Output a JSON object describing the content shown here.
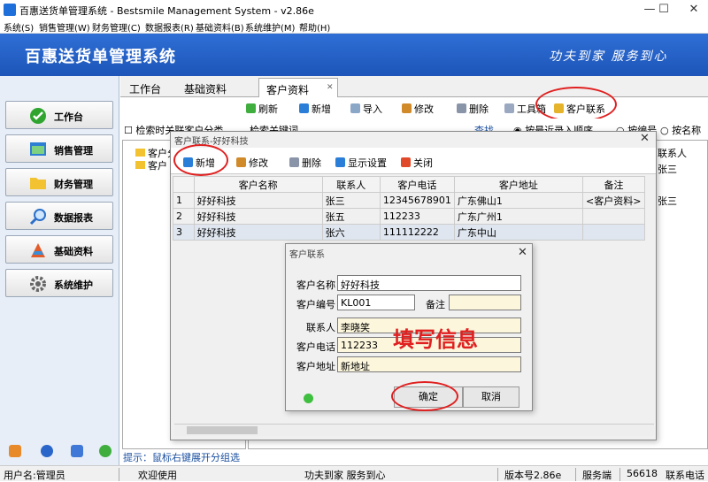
{
  "window": {
    "title": "百惠送货单管理系统 - Bestsmile Management System - v2.86e",
    "min": "—",
    "max": "☐",
    "close": "✕"
  },
  "menu": [
    "系统(S)",
    "销售管理(W)",
    "财务管理(C)",
    "数据报表(R)",
    "基础资料(B)",
    "系统维护(M)",
    "帮助(H)"
  ],
  "banner": {
    "title": "百惠送货单管理系统",
    "slogan": "功夫到家 服务到心"
  },
  "nav": [
    {
      "label": "工作台",
      "icon": "check-icon"
    },
    {
      "label": "销售管理",
      "icon": "window-icon"
    },
    {
      "label": "财务管理",
      "icon": "folder-icon"
    },
    {
      "label": "数据报表",
      "icon": "magnifier-icon"
    },
    {
      "label": "基础资料",
      "icon": "pyramid-icon"
    },
    {
      "label": "系统维护",
      "icon": "gear-icon"
    }
  ],
  "hint": "提示：鼠标右键展开分组选项",
  "tabs": [
    {
      "label": "工作台"
    },
    {
      "label": "基础资料"
    },
    {
      "label": "客户资料"
    }
  ],
  "tab_close": "✕",
  "toolbar": {
    "refresh": "刷新",
    "add": "新增",
    "import": "导入",
    "edit": "修改",
    "delete": "删除",
    "toolbox": "工具箱",
    "contact": "客户联系"
  },
  "search": {
    "checkbox": "检索时关联客户分类",
    "keyword": "检索关键词",
    "btn": "查找",
    "radio1": "按最近录入顺序",
    "radio2": "按编号",
    "radio3": "按名称"
  },
  "tree": {
    "node1": "客户分",
    "node2": "客户"
  },
  "bg_grid": {
    "col": "联系人",
    "r1": "张三",
    "r2": "张三"
  },
  "dialog1": {
    "title": "客户联系-好好科技",
    "add": "新增",
    "edit": "修改",
    "delete": "删除",
    "display": "显示设置",
    "close": "关闭",
    "headers": [
      "",
      "客户名称",
      "联系人",
      "客户电话",
      "客户地址",
      "备注"
    ],
    "rows": [
      [
        "1",
        "好好科技",
        "张三",
        "12345678901",
        "广东佛山1",
        "<客户资料>"
      ],
      [
        "2",
        "好好科技",
        "张五",
        "112233",
        "广东广州1",
        ""
      ],
      [
        "3",
        "好好科技",
        "张六",
        "111112222",
        "广东中山",
        ""
      ]
    ]
  },
  "dialog2": {
    "title": "客户联系",
    "name_label": "客户名称",
    "name": "好好科技",
    "code_label": "客户编号",
    "code": "KL001",
    "remark_label": "备注",
    "remark": "",
    "contact_label": "联系人",
    "contact": "李晓笑",
    "phone_label": "客户电话",
    "phone": "112233",
    "addr_label": "客户地址",
    "addr": "新地址",
    "ok": "确定",
    "cancel": "取消"
  },
  "annotation": "填写信息",
  "status": {
    "user": "用户名:管理员",
    "welcome": "欢迎使用",
    "slogan": "功夫到家 服务到心",
    "version": "版本号2.86e",
    "server": "服务端",
    "port": "56618",
    "contact": "联系电话"
  },
  "colors": {
    "banner": "#1d55b8",
    "accent_red": "#e02020",
    "selection": "#dfe6ef",
    "field_yellow": "#fbf6dc"
  }
}
